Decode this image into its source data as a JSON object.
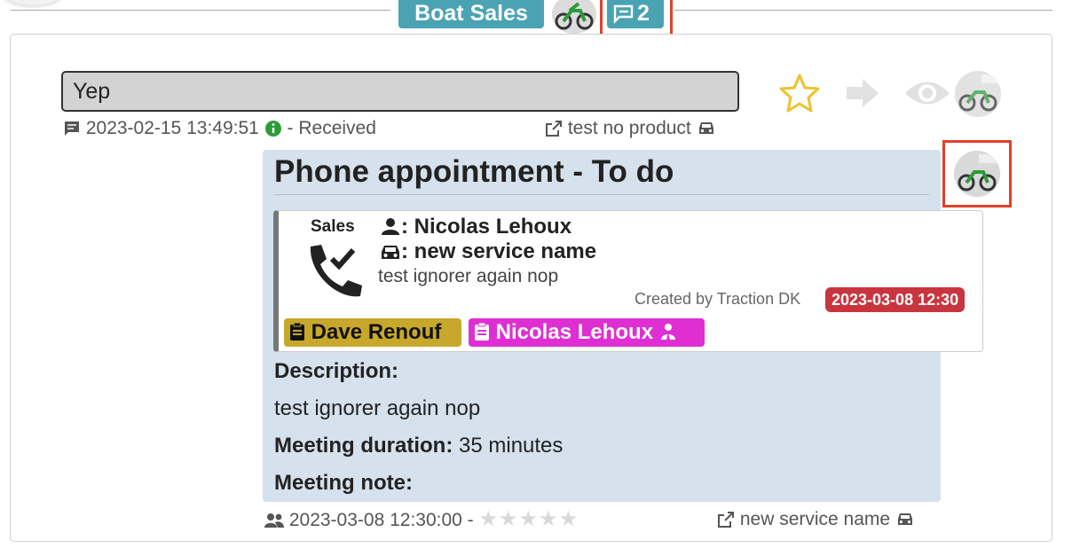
{
  "header": {
    "department_label": "Boat Sales",
    "message_count": "2"
  },
  "message": {
    "text": "Yep",
    "datetime": "2023-02-15 13:49:51",
    "status": "- Received",
    "product_link": "test no product"
  },
  "task": {
    "title": "Phone appointment - To do",
    "category": "Sales",
    "contact_name": ": Nicolas Lehoux",
    "service_name": ": new service name",
    "note": "test ignorer again nop",
    "created_by": "Created by Traction DK",
    "created_date": "2023-03-08 12:30",
    "assignee_1": "Dave Renouf",
    "assignee_2": "Nicolas Lehoux",
    "description_label": "Description:",
    "description_text": "test ignorer again nop",
    "duration_label": "Meeting duration:",
    "duration_value": "35 minutes",
    "meeting_note_label": "Meeting note:",
    "footer_datetime": "2023-03-08 12:30:00 -",
    "footer_service_link": "new service name",
    "rating_stars": 0
  },
  "colors": {
    "pill_teal": "#4aa3b3",
    "highlight_red": "#e0402c",
    "card_blue": "#d5e1ec",
    "star_gold": "#f0c12e",
    "date_badge_red": "#c9353e",
    "tag_olive": "#c8a82c",
    "tag_magenta": "#df2fd3"
  },
  "icons": {
    "message": "comment-icon",
    "info": "info-circle-icon",
    "external": "external-link-icon",
    "car": "car-icon",
    "user": "user-icon",
    "phone": "phone-check-icon",
    "clipboard": "clipboard-icon",
    "group": "users-icon",
    "star": "star-icon",
    "forward": "arrow-right-icon",
    "eye": "eye-icon"
  }
}
